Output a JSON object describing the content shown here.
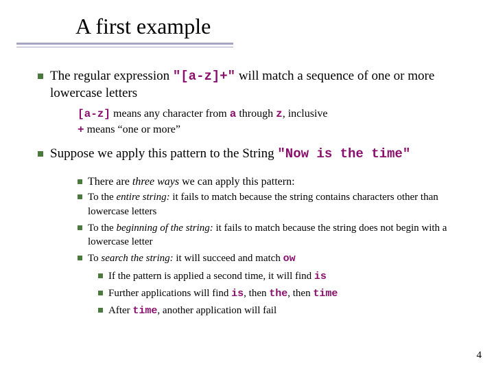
{
  "title": "A first example",
  "b1_a": "The regular expression ",
  "b1_code": "\"[a-z]+\"",
  "b1_b": " will match a sequence of one or more lowercase letters",
  "s1a_code1": "[a-z]",
  "s1a_t1": " means any character from ",
  "s1a_code2": "a",
  "s1a_t2": " through ",
  "s1a_code3": "z",
  "s1a_t3": ", inclusive",
  "s1b_code": "+",
  "s1b_t": " means “one or more”",
  "b2_a": "Suppose we apply this pattern to the String ",
  "b2_code": "\"Now is the time\"",
  "b3_a": "There are ",
  "b3_i": "three ways",
  "b3_b": " we can apply this pattern:",
  "w1_a": "To the ",
  "w1_i": "entire string:",
  "w1_b": " it fails to match because the string contains characters other than lowercase letters",
  "w2_a": "To the ",
  "w2_i": "beginning of the string:",
  "w2_b": " it fails to match because the string does not begin with a lowercase letter",
  "w3_a": "To ",
  "w3_i": "search the string:",
  "w3_b": " it will succeed and match ",
  "w3_code": "ow",
  "d1_a": "If the pattern is applied a second time, it will find ",
  "d1_code": "is",
  "d2_a": "Further applications will find ",
  "d2_c1": "is",
  "d2_t1": ", then ",
  "d2_c2": "the",
  "d2_t2": ", then ",
  "d2_c3": "time",
  "d3_a": "After ",
  "d3_code": "time",
  "d3_b": ", another application will fail",
  "page": "4"
}
